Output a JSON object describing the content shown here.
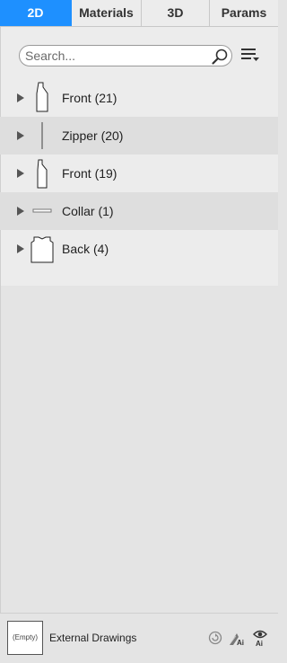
{
  "tabs": [
    {
      "label": "2D",
      "active": true
    },
    {
      "label": "Materials",
      "active": false
    },
    {
      "label": "3D",
      "active": false
    },
    {
      "label": "Params",
      "active": false
    }
  ],
  "search": {
    "placeholder": "Search...",
    "value": ""
  },
  "icons": {
    "search": "search-icon",
    "menu": "sort-menu-icon",
    "expand": "expand-arrow-icon"
  },
  "pieces": [
    {
      "label": "Front (21)",
      "shape": "front-piece"
    },
    {
      "label": "Zipper (20)",
      "shape": "zipper-piece"
    },
    {
      "label": "Front (19)",
      "shape": "front-piece"
    },
    {
      "label": "Collar (1)",
      "shape": "collar-piece"
    },
    {
      "label": "Back (4)",
      "shape": "back-piece"
    }
  ],
  "bottom": {
    "empty_label": "(Empty)",
    "external_drawings_label": "External Drawings"
  },
  "colors": {
    "accent": "#1e90ff",
    "panel": "#ececec",
    "background": "#e4e4e4"
  }
}
